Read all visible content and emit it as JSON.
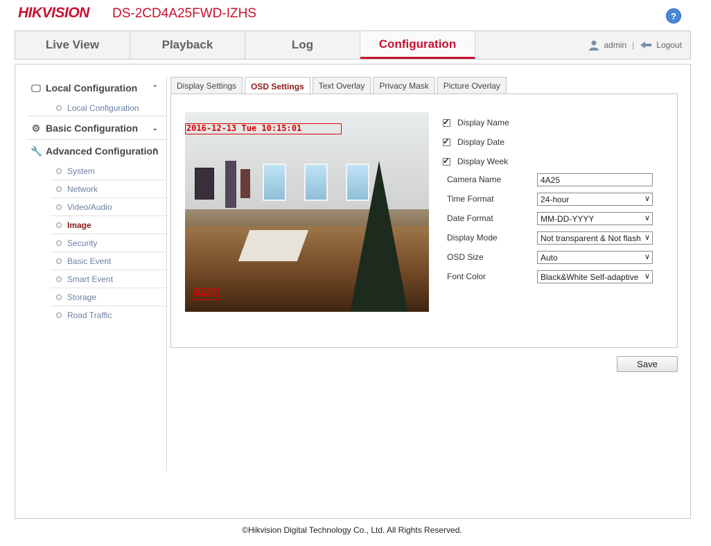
{
  "header": {
    "brand": "HIKVISION",
    "model": "DS-2CD4A25FWD-IZHS",
    "help": "?"
  },
  "nav": {
    "tabs": [
      "Live View",
      "Playback",
      "Log",
      "Configuration"
    ],
    "user": "admin",
    "separator": "|",
    "logout": "Logout"
  },
  "sidebar": {
    "local": {
      "title": "Local Configuration",
      "items": [
        "Local Configuration"
      ]
    },
    "basic": {
      "title": "Basic Configuration"
    },
    "advanced": {
      "title": "Advanced Configuration",
      "items": [
        "System",
        "Network",
        "Video/Audio",
        "Image",
        "Security",
        "Basic Event",
        "Smart Event",
        "Storage",
        "Road Traffic"
      ]
    }
  },
  "tabs": [
    "Display Settings",
    "OSD Settings",
    "Text Overlay",
    "Privacy Mask",
    "Picture Overlay"
  ],
  "preview": {
    "osd_date_text": "2016-12-13 Tue 10:15:01",
    "osd_name_text": "4A25"
  },
  "form": {
    "display_name": "Display Name",
    "display_date": "Display Date",
    "display_week": "Display Week",
    "camera_name_label": "Camera Name",
    "camera_name_value": "4A25",
    "time_format_label": "Time Format",
    "time_format_value": "24-hour",
    "date_format_label": "Date Format",
    "date_format_value": "MM-DD-YYYY",
    "display_mode_label": "Display Mode",
    "display_mode_value": "Not transparent & Not flash",
    "osd_size_label": "OSD Size",
    "osd_size_value": "Auto",
    "font_color_label": "Font Color",
    "font_color_value": "Black&White Self-adaptive"
  },
  "save_label": "Save",
  "footer": "©Hikvision Digital Technology Co., Ltd. All Rights Reserved.",
  "colors": {
    "brand_red": "#c8102e",
    "active_item": "#8b1a1a",
    "link_blue": "#6b7fa3"
  }
}
